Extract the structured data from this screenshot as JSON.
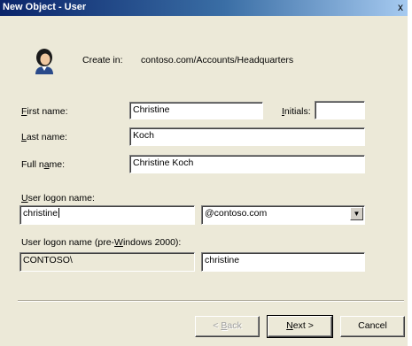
{
  "window": {
    "title": "New Object - User",
    "close_glyph": "x"
  },
  "header": {
    "create_in_label": "Create in:",
    "create_in_path": "contoso.com/Accounts/Headquarters",
    "icon": "user-icon"
  },
  "form": {
    "first_name_label": "First name:",
    "first_name_value": "Christine",
    "initials_label": "Initials:",
    "initials_value": "",
    "last_name_label": "Last name:",
    "last_name_value": "Koch",
    "full_name_label": "Full name:",
    "full_name_value": "Christine Koch",
    "logon_name_label": "User logon name:",
    "logon_name_value": "christine",
    "domain_value": "@contoso.com",
    "pre2000_label": "User logon name (pre-Windows 2000):",
    "pre2000_domain_value": "CONTOSO\\",
    "pre2000_name_value": "christine"
  },
  "buttons": {
    "back": "< Back",
    "next": "Next >",
    "cancel": "Cancel"
  }
}
